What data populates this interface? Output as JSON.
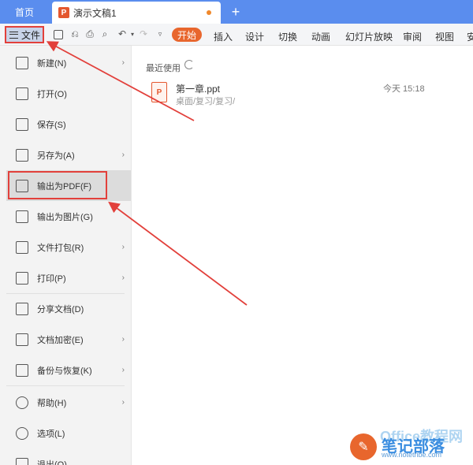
{
  "tabs": {
    "home": "首页",
    "doc": "演示文稿1",
    "add": "+"
  },
  "toolbar": {
    "file_label": "文件",
    "start_label": "开始",
    "menu_tabs": [
      "插入",
      "设计",
      "切换",
      "动画",
      "幻灯片放映",
      "审阅",
      "视图",
      "安"
    ]
  },
  "menu": {
    "items": [
      {
        "label": "新建(N)",
        "icon": "new-file-icon",
        "has_submenu": true
      },
      {
        "label": "打开(O)",
        "icon": "folder-open-icon",
        "has_submenu": false
      },
      {
        "label": "保存(S)",
        "icon": "save-icon",
        "has_submenu": false
      },
      {
        "label": "另存为(A)",
        "icon": "save-as-icon",
        "has_submenu": true
      },
      {
        "label": "输出为PDF(F)",
        "icon": "pdf-export-icon",
        "has_submenu": false
      },
      {
        "label": "输出为图片(G)",
        "icon": "image-export-icon",
        "has_submenu": false
      },
      {
        "label": "文件打包(R)",
        "icon": "package-icon",
        "has_submenu": true
      },
      {
        "label": "打印(P)",
        "icon": "print-icon",
        "has_submenu": true
      },
      {
        "label": "分享文档(D)",
        "icon": "share-icon",
        "has_submenu": false
      },
      {
        "label": "文档加密(E)",
        "icon": "encrypt-icon",
        "has_submenu": true
      },
      {
        "label": "备份与恢复(K)",
        "icon": "backup-icon",
        "has_submenu": true
      },
      {
        "label": "帮助(H)",
        "icon": "help-icon",
        "has_submenu": true
      },
      {
        "label": "选项(L)",
        "icon": "options-gear-icon",
        "has_submenu": false
      },
      {
        "label": "退出(Q)",
        "icon": "exit-icon",
        "has_submenu": false
      }
    ]
  },
  "recent": {
    "title": "最近使用",
    "files": [
      {
        "name": "第一章.ppt",
        "path": "桌面/复习/复习/",
        "time": "今天 15:18"
      }
    ]
  },
  "watermark": {
    "cn": "笔记部落",
    "en": "www.notetribe.com",
    "office": "Office教程网"
  },
  "colors": {
    "tabbar": "#5a8dee",
    "accent": "#e8662d",
    "annotation_red": "#e2403b"
  }
}
